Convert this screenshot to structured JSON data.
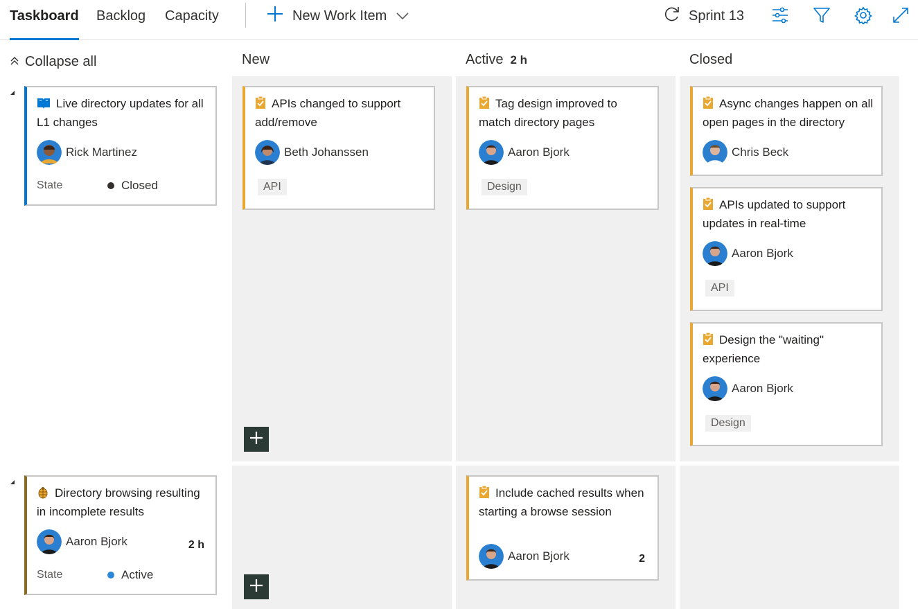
{
  "topbar": {
    "tabs": [
      {
        "label": "Taskboard",
        "active": true
      },
      {
        "label": "Backlog",
        "active": false
      },
      {
        "label": "Capacity",
        "active": false
      }
    ],
    "new_work_item": {
      "label": "New Work Item",
      "icon": "plus-icon",
      "dropdown_icon": "chevron-down-icon"
    },
    "sprint": {
      "label": "Sprint 13",
      "icon": "sprint-cycle-icon"
    },
    "tools": [
      "settings-sliders-icon",
      "filter-icon",
      "gear-icon",
      "fullscreen-icon"
    ],
    "accent_color": "#0078d4"
  },
  "collapse_all": {
    "label": "Collapse all"
  },
  "columns": [
    {
      "name": "New",
      "count": ""
    },
    {
      "name": "Active",
      "count": "2 h"
    },
    {
      "name": "Closed",
      "count": ""
    }
  ],
  "rows": [
    {
      "parent": {
        "type": "story",
        "title": "Live directory updates for all L1 changes",
        "assignee": "Rick Martinez",
        "remaining": "",
        "state_label": "State",
        "state": "Closed",
        "state_color": "#323130"
      },
      "cells": {
        "new": [
          {
            "title": "APIs changed to support add/remove",
            "assignee": "Beth Johanssen",
            "tag": "API",
            "remaining": ""
          }
        ],
        "active": [
          {
            "title": "Tag design improved to match directory pages",
            "assignee": "Aaron Bjork",
            "tag": "Design",
            "remaining": ""
          }
        ],
        "closed": [
          {
            "title": "Async changes happen on all open pages in the directory",
            "assignee": "Chris Beck",
            "tag": "",
            "remaining": ""
          },
          {
            "title": "APIs updated to support updates in real-time",
            "assignee": "Aaron Bjork",
            "tag": "API",
            "remaining": ""
          },
          {
            "title": "Design the \"waiting\" experience",
            "assignee": "Aaron Bjork",
            "tag": "Design",
            "remaining": ""
          }
        ]
      }
    },
    {
      "parent": {
        "type": "bug",
        "title": "Directory browsing resulting in incomplete results",
        "assignee": "Aaron Bjork",
        "remaining": "2 h",
        "state_label": "State",
        "state": "Active",
        "state_color": "#2b88d8"
      },
      "cells": {
        "new": [],
        "active": [
          {
            "title": "Include cached results when starting a browse session",
            "assignee": "Aaron Bjork",
            "tag": "",
            "remaining": "2"
          }
        ],
        "closed": []
      }
    }
  ],
  "colors": {
    "task": "#e8a831",
    "story": "#0078d4",
    "bug": "#8a6d1c",
    "lane_bg": "#f0f0f0",
    "add_button": "#2b3a35"
  }
}
